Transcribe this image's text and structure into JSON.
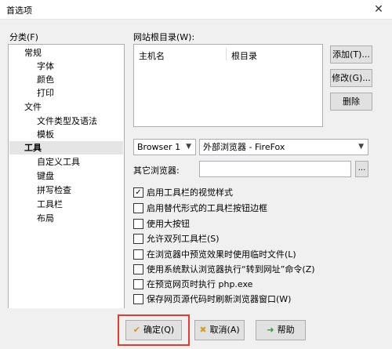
{
  "window": {
    "title": "首选项",
    "close_glyph": "✕"
  },
  "categories": {
    "label": "分类(F)",
    "items": [
      {
        "label": "常规",
        "level": 0,
        "selected": false
      },
      {
        "label": "字体",
        "level": 1,
        "selected": false
      },
      {
        "label": "颜色",
        "level": 1,
        "selected": false
      },
      {
        "label": "打印",
        "level": 1,
        "selected": false
      },
      {
        "label": "文件",
        "level": 0,
        "selected": false
      },
      {
        "label": "文件类型及语法",
        "level": 1,
        "selected": false
      },
      {
        "label": "模板",
        "level": 1,
        "selected": false
      },
      {
        "label": "工具",
        "level": 0,
        "selected": true
      },
      {
        "label": "自定义工具",
        "level": 1,
        "selected": false
      },
      {
        "label": "键盘",
        "level": 1,
        "selected": false
      },
      {
        "label": "拼写检查",
        "level": 1,
        "selected": false
      },
      {
        "label": "工具栏",
        "level": 1,
        "selected": false
      },
      {
        "label": "布局",
        "level": 1,
        "selected": false
      }
    ]
  },
  "website_root": {
    "label": "网站根目录(W):",
    "columns": [
      "主机名",
      "根目录"
    ],
    "buttons": {
      "add": "添加(T)...",
      "edit": "修改(G)...",
      "delete": "删除"
    }
  },
  "browser": {
    "selected": "Browser 1",
    "external": "外部浏览器 - FireFox",
    "other_label": "其它浏览器:",
    "other_value": "",
    "browse_label": "..."
  },
  "options": [
    {
      "label": "启用工具栏的视觉样式",
      "checked": true
    },
    {
      "label": "启用替代形式的工具栏按钮边框",
      "checked": false
    },
    {
      "label": "使用大按钮",
      "checked": false
    },
    {
      "label": "允许双列工具栏(S)",
      "checked": false
    },
    {
      "label": "在浏览器中预览效果时使用临时文件(L)",
      "checked": false
    },
    {
      "label": "使用系统默认浏览器执行“转到网址”命令(Z)",
      "checked": false
    },
    {
      "label": "在预览网页时执行 php.exe",
      "checked": false
    },
    {
      "label": "保存网页源代码时刷新浏览器窗口(W)",
      "checked": false
    }
  ],
  "footer": {
    "ok": "确定(Q)",
    "cancel": "取消(A)",
    "help": "帮助"
  },
  "colors": {
    "highlight": "#e63a2e",
    "ok_icon": "#e8891b",
    "cancel_icon": "#d4a017",
    "help_icon": "#2e9e3f"
  }
}
